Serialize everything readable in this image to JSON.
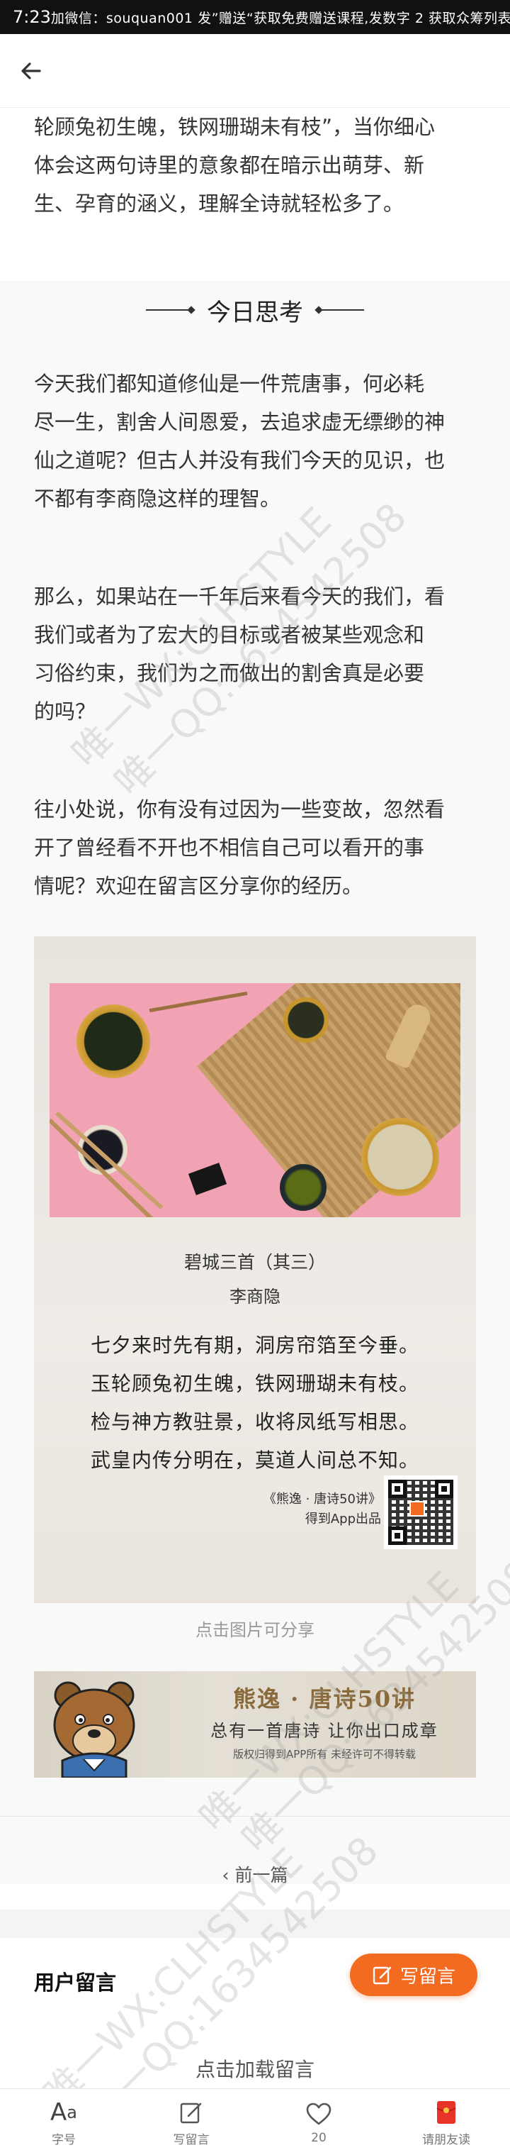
{
  "status_bar": {
    "time": "7:23",
    "ticker": "加微信：souquan001   发”赠送“获取免费赠送课程,发数字 2 获取众筹列表"
  },
  "article": {
    "intro_lines": [
      "轮顾兔初生魄，铁网珊瑚未有枝”，当你细心",
      "体会这两句诗里的意象都在暗示出萌芽、新",
      "生、孕育的涵义，理解全诗就轻松多了。"
    ],
    "section_title": "今日思考",
    "p1": [
      "今天我们都知道修仙是一件荒唐事，何必耗",
      "尽一生，割舍人间恩爱，去追求虚无缥缈的神",
      "仙之道呢？但古人并没有我们今天的见识，也",
      "不都有李商隐这样的理智。"
    ],
    "p2": [
      "那么，如果站在一千年后来看今天的我们，看",
      "我们或者为了宏大的目标或者被某些观念和",
      "习俗约束，我们为之而做出的割舍真是必要",
      "的吗？"
    ],
    "p3": [
      "往小处说，你有没有过因为一些变故，忽然看",
      "开了曾经看不开也不相信自己可以看开的事",
      "情呢？欢迎在留言区分享你的经历。"
    ]
  },
  "poem_card": {
    "title": "碧城三首（其三）",
    "author": "李商隐",
    "lines": [
      "七夕来时先有期，洞房帘箔至今垂。",
      "玉轮顾兔初生魄，铁网珊瑚未有枝。",
      "检与神方教驻景，收将凤纸写相思。",
      "武皇内传分明在，莫道人间总不知。"
    ],
    "brand_line1": "《熊逸 · 唐诗50讲》",
    "brand_line2": "得到App出品",
    "share_hint": "点击图片可分享"
  },
  "banner": {
    "title": "熊逸 · 唐诗50讲",
    "subtitle": "总有一首唐诗 让你出口成章",
    "small": "版权归得到APP所有 未经许可不得转载"
  },
  "nav": {
    "prev_label": "前一篇"
  },
  "comments": {
    "title": "用户留言",
    "write_label": "写留言",
    "load_label": "点击加载留言"
  },
  "toolbar": {
    "items": [
      {
        "label": "字号",
        "icon": "font-size-icon"
      },
      {
        "label": "写留言",
        "icon": "edit-icon"
      },
      {
        "label": "20",
        "icon": "heart-icon"
      },
      {
        "label": "请朋友读",
        "icon": "red-envelope-icon"
      }
    ]
  },
  "watermark": {
    "text1": "唯一WX:CLHSTYLE",
    "text2": "唯一QQ:1634542508"
  },
  "colors": {
    "accent": "#f26b21",
    "text": "#333333",
    "muted": "#9a9a9a",
    "poem_bg": "#ebe7e1",
    "photo_pink": "#f1a3b4",
    "red_envelope": "#e8332a"
  }
}
